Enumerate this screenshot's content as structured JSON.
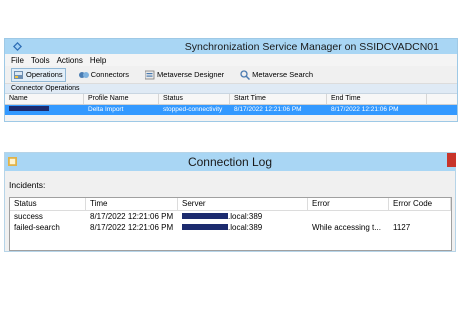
{
  "sync_manager": {
    "title": "Synchronization Service Manager on SSIDCVADCN01",
    "menu": [
      "File",
      "Tools",
      "Actions",
      "Help"
    ],
    "toolbar": [
      "Operations",
      "Connectors",
      "Metaverse Designer",
      "Metaverse Search"
    ],
    "section_label": "Connector Operations",
    "columns": [
      "Name",
      "Profile Name",
      "Status",
      "Start Time",
      "End Time"
    ],
    "row": {
      "profile": "Delta Import",
      "status": "stopped-connectivity",
      "start": "8/17/2022 12:21:06 PM",
      "end": "8/17/2022 12:21:06 PM"
    },
    "colors": {
      "title_bar": "#a9d6f4",
      "selection": "#3399ff",
      "redaction": "#1c2b6e"
    }
  },
  "connection_log": {
    "title": "Connection Log",
    "incidents_label": "Incidents:",
    "columns": [
      "Status",
      "Time",
      "Server",
      "Error",
      "Error Code"
    ],
    "rows": [
      {
        "status": "success",
        "time": "8/17/2022 12:21:06 PM",
        "server_suffix": ".local:389",
        "error": "",
        "code": ""
      },
      {
        "status": "failed-search",
        "time": "8/17/2022 12:21:06 PM",
        "server_suffix": ".local:389",
        "error": "While accessing t...",
        "code": "1127"
      }
    ]
  }
}
